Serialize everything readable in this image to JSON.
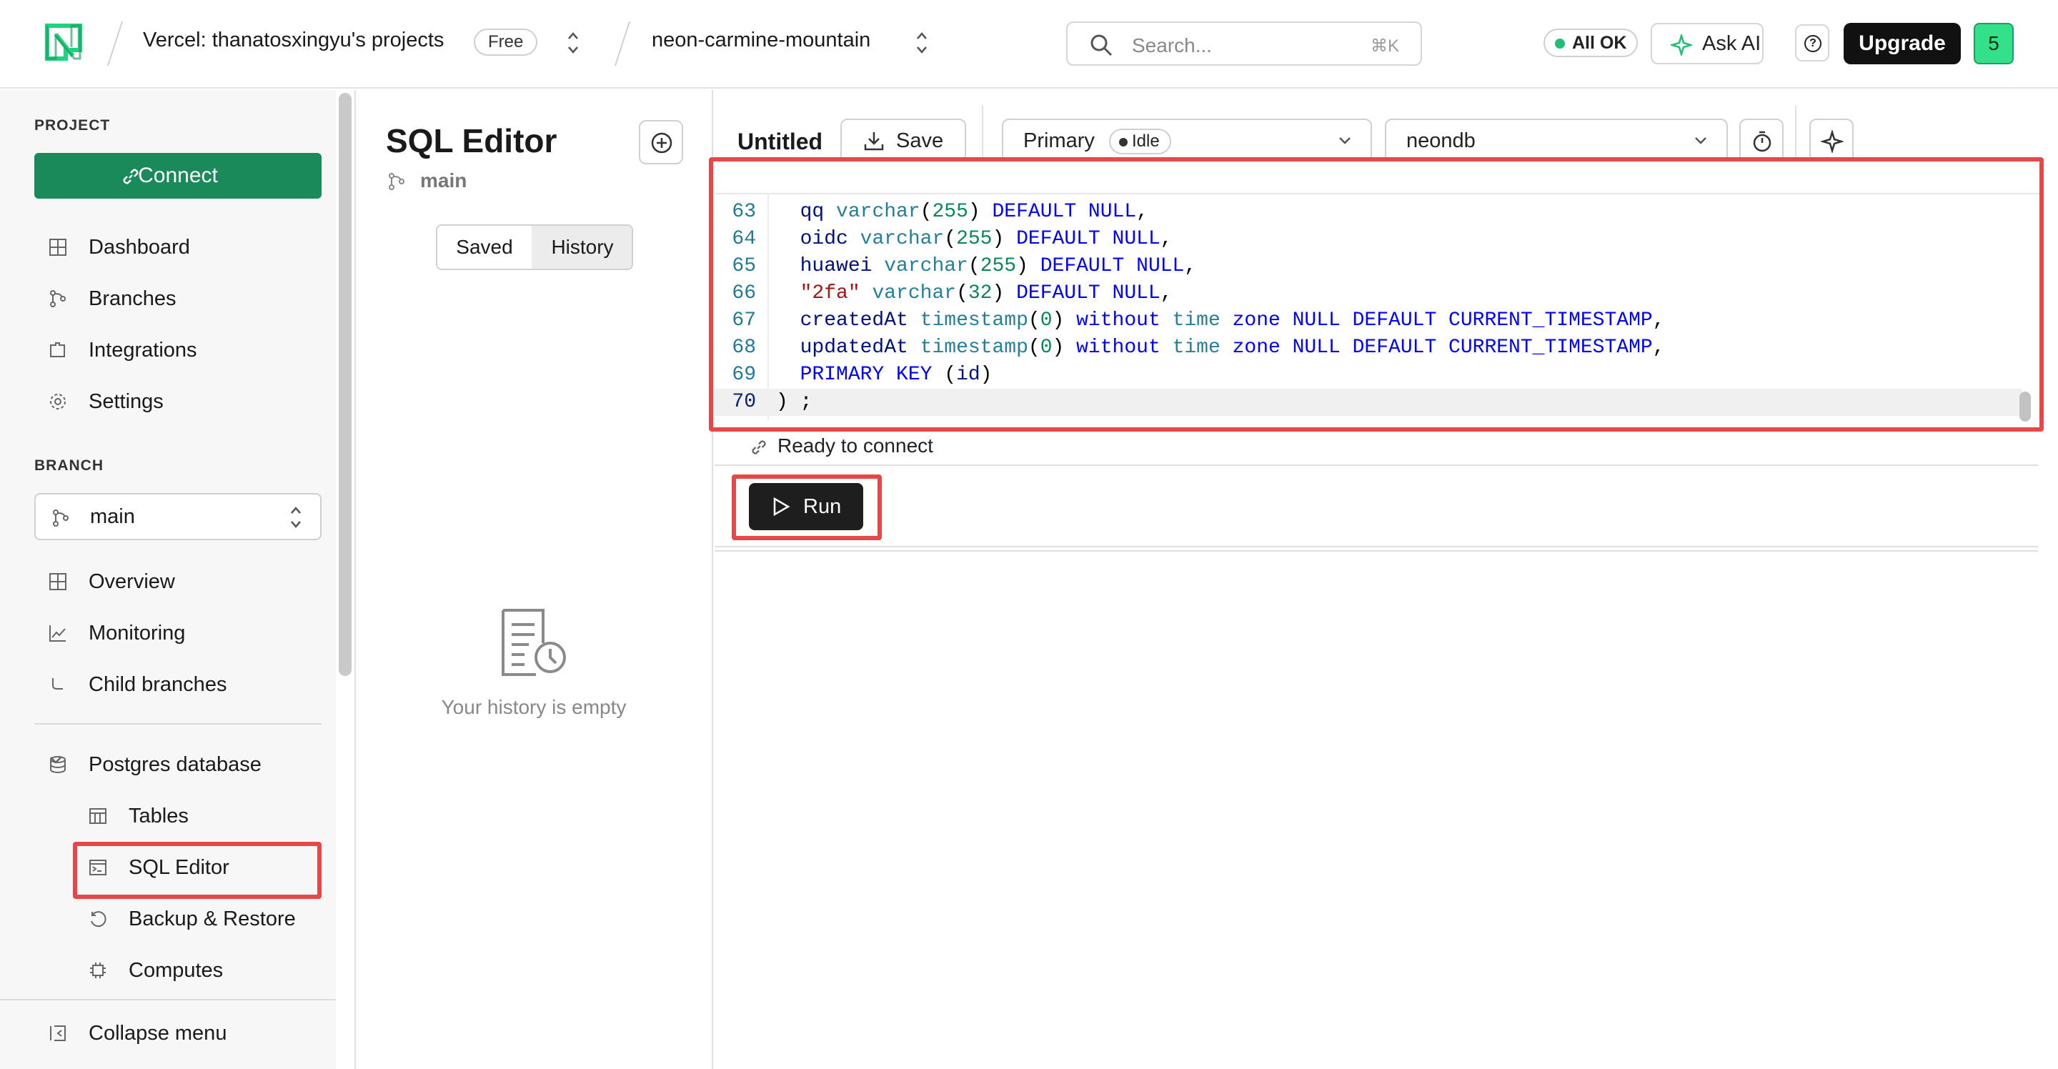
{
  "topbar": {
    "org": "Vercel: thanatosxingyu's projects",
    "plan": "Free",
    "project": "neon-carmine-mountain",
    "search_placeholder": "Search...",
    "search_shortcut": "⌘K",
    "status": "All OK",
    "ask_ai": "Ask AI",
    "help": "?",
    "upgrade": "Upgrade",
    "avatar": "5"
  },
  "sidebar": {
    "project_label": "PROJECT",
    "connect": "Connect",
    "project_items": [
      {
        "label": "Dashboard",
        "icon": "dashboard-icon"
      },
      {
        "label": "Branches",
        "icon": "branches-icon"
      },
      {
        "label": "Integrations",
        "icon": "integrations-icon"
      },
      {
        "label": "Settings",
        "icon": "gear-icon"
      }
    ],
    "branch_label": "BRANCH",
    "branch_value": "main",
    "branch_items": [
      {
        "label": "Overview",
        "icon": "overview-icon"
      },
      {
        "label": "Monitoring",
        "icon": "monitoring-icon"
      },
      {
        "label": "Child branches",
        "icon": "child-branch-icon"
      }
    ],
    "postgres_label": "Postgres database",
    "db_items": [
      {
        "label": "Tables",
        "icon": "table-icon"
      },
      {
        "label": "SQL Editor",
        "icon": "terminal-icon",
        "active": true
      },
      {
        "label": "Backup & Restore",
        "icon": "restore-icon"
      },
      {
        "label": "Computes",
        "icon": "chip-icon"
      }
    ],
    "collapse": "Collapse menu"
  },
  "middle": {
    "title": "SQL Editor",
    "branch": "main",
    "tabs": [
      "Saved",
      "History"
    ],
    "active_tab": "History",
    "empty_text": "Your history is empty"
  },
  "editor": {
    "tab_title": "Untitled",
    "save": "Save",
    "compute": "Primary",
    "compute_state": "Idle",
    "database": "neondb",
    "active_line": 70,
    "lines": [
      {
        "n": "63",
        "segs": [
          [
            "",
            "  "
          ],
          [
            "i",
            "qq"
          ],
          [
            "",
            " "
          ],
          [
            "t",
            "varchar"
          ],
          [
            "",
            "("
          ],
          [
            "n",
            "255"
          ],
          [
            "",
            ") "
          ],
          [
            "k",
            "DEFAULT NULL"
          ],
          [
            "",
            ","
          ]
        ]
      },
      {
        "n": "64",
        "segs": [
          [
            "",
            "  "
          ],
          [
            "i",
            "oidc"
          ],
          [
            "",
            " "
          ],
          [
            "t",
            "varchar"
          ],
          [
            "",
            "("
          ],
          [
            "n",
            "255"
          ],
          [
            "",
            ") "
          ],
          [
            "k",
            "DEFAULT NULL"
          ],
          [
            "",
            ","
          ]
        ]
      },
      {
        "n": "65",
        "segs": [
          [
            "",
            "  "
          ],
          [
            "i",
            "huawei"
          ],
          [
            "",
            " "
          ],
          [
            "t",
            "varchar"
          ],
          [
            "",
            "("
          ],
          [
            "n",
            "255"
          ],
          [
            "",
            ") "
          ],
          [
            "k",
            "DEFAULT NULL"
          ],
          [
            "",
            ","
          ]
        ]
      },
      {
        "n": "66",
        "segs": [
          [
            "",
            "  "
          ],
          [
            "s",
            "\"2fa\""
          ],
          [
            "",
            " "
          ],
          [
            "t",
            "varchar"
          ],
          [
            "",
            "("
          ],
          [
            "n",
            "32"
          ],
          [
            "",
            ") "
          ],
          [
            "k",
            "DEFAULT NULL"
          ],
          [
            "",
            ","
          ]
        ]
      },
      {
        "n": "67",
        "segs": [
          [
            "",
            "  "
          ],
          [
            "i",
            "createdAt"
          ],
          [
            "",
            " "
          ],
          [
            "t",
            "timestamp"
          ],
          [
            "",
            "("
          ],
          [
            "n",
            "0"
          ],
          [
            "",
            ") "
          ],
          [
            "k",
            "without"
          ],
          [
            "",
            " "
          ],
          [
            "t",
            "time"
          ],
          [
            "",
            " "
          ],
          [
            "k",
            "zone NULL DEFAULT CURRENT_TIMESTAMP"
          ],
          [
            "",
            ","
          ]
        ]
      },
      {
        "n": "68",
        "segs": [
          [
            "",
            "  "
          ],
          [
            "i",
            "updatedAt"
          ],
          [
            "",
            " "
          ],
          [
            "t",
            "timestamp"
          ],
          [
            "",
            "("
          ],
          [
            "n",
            "0"
          ],
          [
            "",
            ") "
          ],
          [
            "k",
            "without"
          ],
          [
            "",
            " "
          ],
          [
            "t",
            "time"
          ],
          [
            "",
            " "
          ],
          [
            "k",
            "zone NULL DEFAULT CURRENT_TIMESTAMP"
          ],
          [
            "",
            ","
          ]
        ]
      },
      {
        "n": "69",
        "segs": [
          [
            "",
            "  "
          ],
          [
            "k",
            "PRIMARY KEY"
          ],
          [
            "",
            " ("
          ],
          [
            "i",
            "id"
          ],
          [
            "",
            ")"
          ]
        ]
      },
      {
        "n": "70",
        "segs": [
          [
            "",
            ") ;"
          ]
        ]
      }
    ],
    "ready": "Ready to connect",
    "run": "Run"
  },
  "colors": {
    "accent_green": "#1b8a5a",
    "highlight_red": "#e64848",
    "status_green": "#1fbf78",
    "avatar_green": "#35e08a"
  }
}
